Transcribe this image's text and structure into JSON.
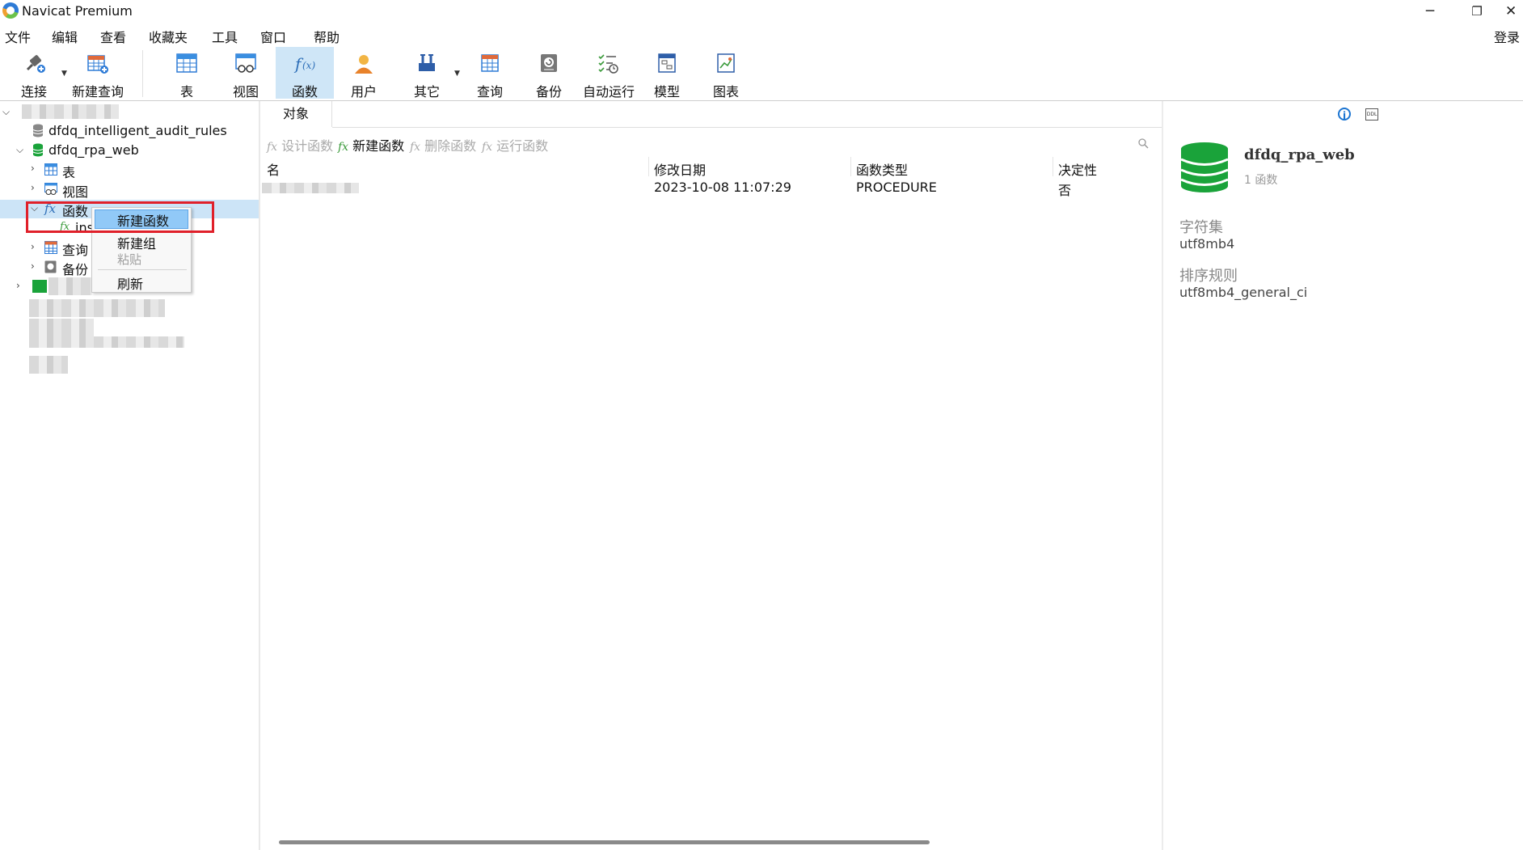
{
  "window": {
    "title": "Navicat Premium",
    "minimize": "─",
    "restore": "❐",
    "close": "✕"
  },
  "menu": [
    "文件",
    "编辑",
    "查看",
    "收藏夹",
    "工具",
    "窗口",
    "帮助"
  ],
  "login": "登录",
  "toolbar": {
    "connect": "连接",
    "new_query": "新建查询",
    "table": "表",
    "view": "视图",
    "function": "函数",
    "user": "用户",
    "other": "其它",
    "query": "查询",
    "backup": "备份",
    "autorun": "自动运行",
    "model": "模型",
    "chart": "图表",
    "active": "function"
  },
  "sidebar": {
    "db1": "dfdq_intelligent_audit_rules",
    "db2": "dfdq_rpa_web",
    "nodes": {
      "tables": "表",
      "views": "视图",
      "functions": "函数",
      "function_child": "ins",
      "queries": "查询",
      "backups": "备份"
    }
  },
  "context_menu": {
    "new_function": "新建函数",
    "new_group": "新建组",
    "paste": "粘贴",
    "refresh": "刷新"
  },
  "tabs": {
    "objects": "对象"
  },
  "object_toolbar": {
    "design": "设计函数",
    "new": "新建函数",
    "delete": "删除函数",
    "run": "运行函数",
    "fx": "fx"
  },
  "table": {
    "columns": [
      "名",
      "修改日期",
      "函数类型",
      "决定性"
    ],
    "rows": [
      {
        "name": "",
        "modified": "2023-10-08 11:07:29",
        "type": "PROCEDURE",
        "deterministic": "否"
      }
    ]
  },
  "info": {
    "db_name": "dfdq_rpa_web",
    "count": "1 函数",
    "charset_label": "字符集",
    "charset": "utf8mb4",
    "collation_label": "排序规则",
    "collation": "utf8mb4_general_ci",
    "info_icon": "i",
    "ddl_icon": "DDL"
  },
  "colors": {
    "accent": "#1b74d1",
    "selection": "#cce4f7",
    "highlight_box": "#e0202a",
    "db_green": "#1aa33a"
  }
}
